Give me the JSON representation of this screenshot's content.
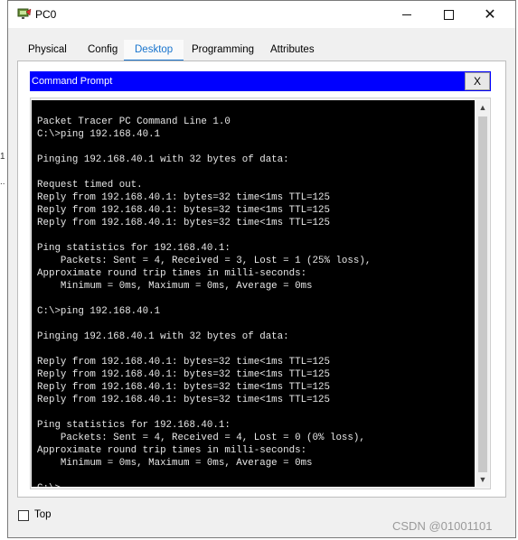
{
  "window": {
    "title": "PC0",
    "minimize_icon": "minimize-icon",
    "maximize_icon": "maximize-icon",
    "close_icon": "close-icon"
  },
  "tabs": [
    {
      "label": "Physical"
    },
    {
      "label": "Config"
    },
    {
      "label": "Desktop",
      "active": true
    },
    {
      "label": "Programming"
    },
    {
      "label": "Attributes"
    }
  ],
  "command_prompt": {
    "title": "Command Prompt",
    "close_label": "X",
    "output": "Packet Tracer PC Command Line 1.0\nC:\\>ping 192.168.40.1\n\nPinging 192.168.40.1 with 32 bytes of data:\n\nRequest timed out.\nReply from 192.168.40.1: bytes=32 time<1ms TTL=125\nReply from 192.168.40.1: bytes=32 time<1ms TTL=125\nReply from 192.168.40.1: bytes=32 time<1ms TTL=125\n\nPing statistics for 192.168.40.1:\n    Packets: Sent = 4, Received = 3, Lost = 1 (25% loss),\nApproximate round trip times in milli-seconds:\n    Minimum = 0ms, Maximum = 0ms, Average = 0ms\n\nC:\\>ping 192.168.40.1\n\nPinging 192.168.40.1 with 32 bytes of data:\n\nReply from 192.168.40.1: bytes=32 time<1ms TTL=125\nReply from 192.168.40.1: bytes=32 time<1ms TTL=125\nReply from 192.168.40.1: bytes=32 time<1ms TTL=125\nReply from 192.168.40.1: bytes=32 time<1ms TTL=125\n\nPing statistics for 192.168.40.1:\n    Packets: Sent = 4, Received = 4, Lost = 0 (0% loss),\nApproximate round trip times in milli-seconds:\n    Minimum = 0ms, Maximum = 0ms, Average = 0ms\n\nC:\\>"
  },
  "footer": {
    "top_label": "Top",
    "top_checked": false
  },
  "watermark": "CSDN @01001101",
  "colors": {
    "accent": "#1874cd",
    "cmd_header": "#0000ff",
    "terminal_bg": "#000000",
    "terminal_fg": "#e8e8e8"
  }
}
